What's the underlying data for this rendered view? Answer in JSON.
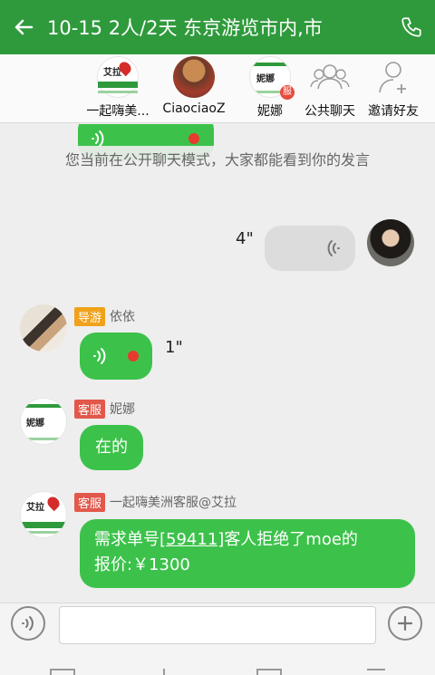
{
  "header": {
    "title": "10-15 2人/2天 东京游览市内,市",
    "back_icon": "arrow-left-icon",
    "call_icon": "phone-icon",
    "bg_color": "#2f9a3c"
  },
  "members": [
    {
      "name": "一起嗨美...",
      "avatar": "aila-logo",
      "logo_text": "艾拉"
    },
    {
      "name": "CiaociaoZ",
      "avatar": "photo"
    },
    {
      "name": "妮娜",
      "avatar": "nina-logo",
      "logo_text": "妮娜",
      "badge": "服"
    },
    {
      "name": "公共聊天",
      "avatar": "group-icon"
    },
    {
      "name": "邀请好友",
      "avatar": "add-user-icon"
    }
  ],
  "notice": "您当前在公开聊天模式，大家都能看到你的发言",
  "messages": [
    {
      "type": "voice",
      "side": "left",
      "unread": true
    },
    {
      "type": "voice",
      "side": "right",
      "duration": "4\""
    },
    {
      "type": "voice",
      "side": "left",
      "role": "导游",
      "sender": "依依",
      "duration": "1\"",
      "unread": true
    },
    {
      "type": "text",
      "side": "left",
      "role": "客服",
      "sender": "妮娜",
      "logo_text": "妮娜",
      "text": "在的"
    },
    {
      "type": "text",
      "side": "left",
      "role": "客服",
      "sender": "一起嗨美洲客服@艾拉",
      "logo_text": "艾拉",
      "text_prefix": "需求单号",
      "order_no": "[59411]",
      "text_suffix": "客人拒绝了moe的",
      "text_line2": "报价:￥1300"
    }
  ],
  "input": {
    "placeholder": "",
    "voice_icon": "voice-input-icon",
    "plus_icon": "plus-icon"
  },
  "colors": {
    "green": "#3cc24a",
    "guide_tag": "#f0a21b",
    "cs_tag": "#e2584b",
    "unread_dot": "#e63b2e"
  }
}
